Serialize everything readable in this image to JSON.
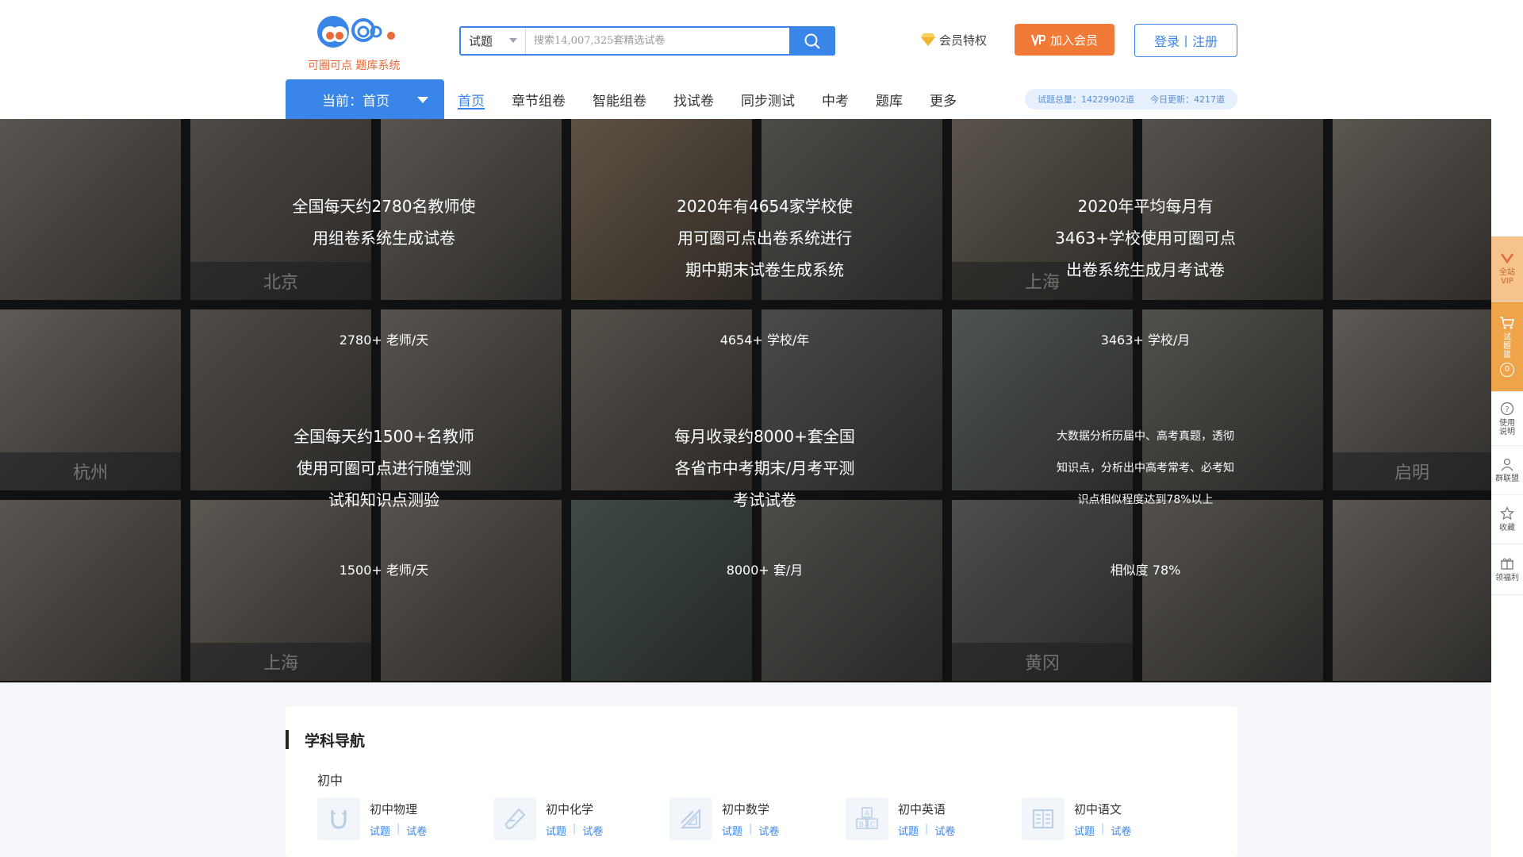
{
  "header": {
    "logo_sub": "可圈可点 题库系统",
    "search_type": "试题",
    "search_placeholder": "搜索14,007,325套精选试卷",
    "vip_priv": "会员特权",
    "join": "加入会员",
    "login": "登录丨注册"
  },
  "nav": {
    "current": "当前：首页",
    "links": [
      "首页",
      "章节组卷",
      "智能组卷",
      "找试卷",
      "同步测试",
      "中考",
      "题库",
      "更多"
    ],
    "stats_total": "试题总量：14229902道",
    "stats_today": "今日更新：4217道"
  },
  "hero": {
    "cities": [
      "北京",
      "上海",
      "杭州",
      "启明",
      "上海",
      "黄冈"
    ],
    "panels": [
      {
        "desc": [
          "全国每天约2780名教师使",
          "用组卷系统生成试卷"
        ],
        "num": "2780+",
        "unit": "老师/天"
      },
      {
        "desc": [
          "2020年有4654家学校使",
          "用可圈可点出卷系统进行",
          "期中期末试卷生成系统"
        ],
        "num": "4654+",
        "unit": "学校/年"
      },
      {
        "desc": [
          "2020年平均每月有",
          "3463+学校使用可圈可点",
          "出卷系统生成月考试卷"
        ],
        "num": "3463+",
        "unit": "学校/月"
      },
      {
        "desc": [
          "全国每天约1500+名教师",
          "使用可圈可点进行随堂测",
          "试和知识点测验"
        ],
        "num": "1500+",
        "unit": "老师/天"
      },
      {
        "desc": [
          "每月收录约8000+套全国",
          "各省市中考期末/月考平测",
          "考试试卷"
        ],
        "num": "8000+",
        "unit": "套/月"
      },
      {
        "desc": [
          "大数据分析历届中、高考真题，透彻",
          "知识点，分析出中高考常考、必考知",
          "识点相似程度达到78%以上"
        ],
        "pre": "相似度",
        "num": "78%"
      }
    ]
  },
  "sidebar": {
    "vip": "全站VIP",
    "basket": "试题篮",
    "basket_count": "0",
    "help": "使用说明",
    "alliance": "群联盟",
    "favorite": "收藏",
    "welfare": "领福利"
  },
  "subjects": {
    "title": "学科导航",
    "level": "初中",
    "link_q": "试题",
    "link_p": "试卷",
    "items": [
      "初中物理",
      "初中化学",
      "初中数学",
      "初中英语",
      "初中语文"
    ]
  },
  "colors": {
    "accent": "#3a86e8",
    "orange": "#f07a36",
    "highlight": "#f39a3c"
  }
}
